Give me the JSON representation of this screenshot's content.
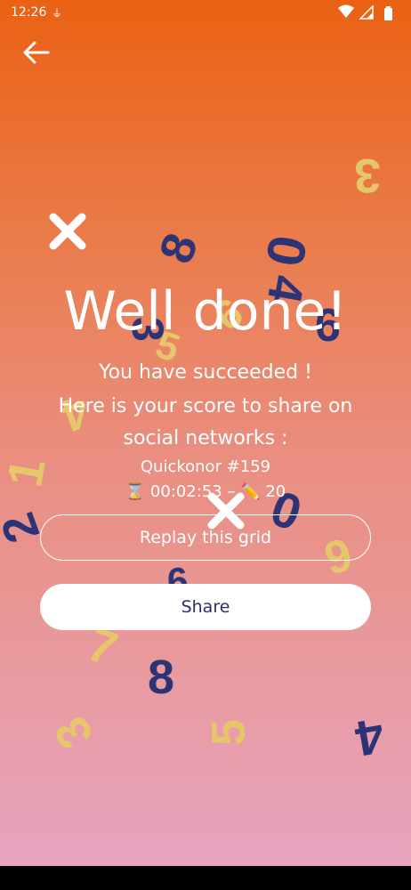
{
  "status_bar": {
    "time": "12:26"
  },
  "header": {
    "back_icon": "arrow-left-icon"
  },
  "result": {
    "title": "Well done!",
    "line1": "You have succeeded !",
    "line2": "Here is your score to share on",
    "line3": "social networks :",
    "puzzle_id": "Quickonor #159",
    "time_emoji": "⌛",
    "time": "00:02:53",
    "separator": "–",
    "edits_emoji": "✏️",
    "edits": "20"
  },
  "buttons": {
    "replay": "Replay this grid",
    "share": "Share"
  },
  "decor": {
    "colors": {
      "navy": "#2d3476",
      "gold": "#e6c66b",
      "white": "#ffffff"
    },
    "digits": [
      "3",
      "8",
      "0",
      "4",
      "6",
      "9",
      "3",
      "5",
      "4",
      "1",
      "2",
      "0",
      "9",
      "6",
      "7",
      "8",
      "3",
      "5",
      "4"
    ]
  }
}
